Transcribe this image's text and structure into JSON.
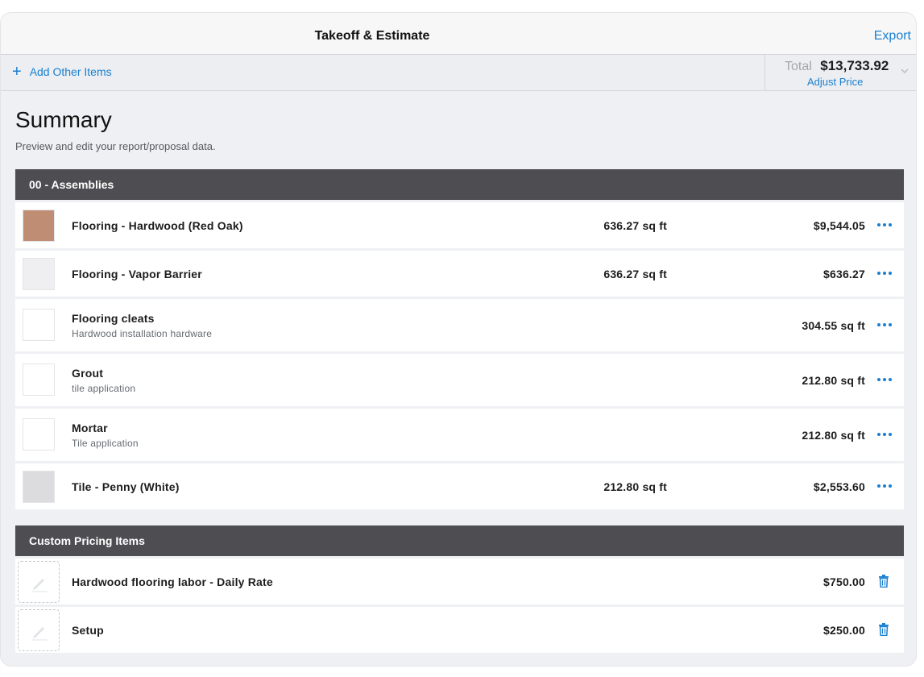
{
  "navbar": {
    "title": "Takeoff & Estimate",
    "export_label": "Export"
  },
  "toolbar": {
    "add_items_label": "Add Other Items",
    "total_label": "Total",
    "total_value": "$13,733.92",
    "adjust_price_label": "Adjust Price"
  },
  "summary": {
    "title": "Summary",
    "subtitle": "Preview and edit your report/proposal data."
  },
  "assemblies": {
    "header": "00 - Assemblies",
    "items": [
      {
        "name": "Flooring - Hardwood (Red Oak)",
        "description": "",
        "quantity": "636.27 sq ft",
        "price": "$9,544.05",
        "swatch": "#bf8c74"
      },
      {
        "name": "Flooring - Vapor Barrier",
        "description": "",
        "quantity": "636.27 sq ft",
        "price": "$636.27",
        "swatch": "#efeef0"
      },
      {
        "name": "Flooring cleats",
        "description": "Hardwood installation hardware",
        "quantity": "",
        "price": "304.55 sq ft",
        "swatch": "#ffffff"
      },
      {
        "name": "Grout",
        "description": "tile application",
        "quantity": "",
        "price": "212.80 sq ft",
        "swatch": "#ffffff"
      },
      {
        "name": "Mortar",
        "description": "Tile application",
        "quantity": "",
        "price": "212.80 sq ft",
        "swatch": "#ffffff"
      },
      {
        "name": "Tile - Penny (White)",
        "description": "",
        "quantity": "212.80 sq ft",
        "price": "$2,553.60",
        "swatch": "#dcdcde"
      }
    ]
  },
  "custom_pricing": {
    "header": "Custom Pricing Items",
    "items": [
      {
        "name": "Hardwood flooring labor - Daily Rate",
        "price": "$750.00"
      },
      {
        "name": "Setup",
        "price": "$250.00"
      }
    ]
  },
  "icons": {
    "add": "plus-icon",
    "dropdown": "chevron-down-icon",
    "row_menu": "more-icon",
    "delete": "trash-icon",
    "custom_item": "pencil-icon"
  },
  "colors": {
    "accent": "#1a7fd0",
    "section_header": "#4e4d51",
    "background": "#eef0f3"
  }
}
